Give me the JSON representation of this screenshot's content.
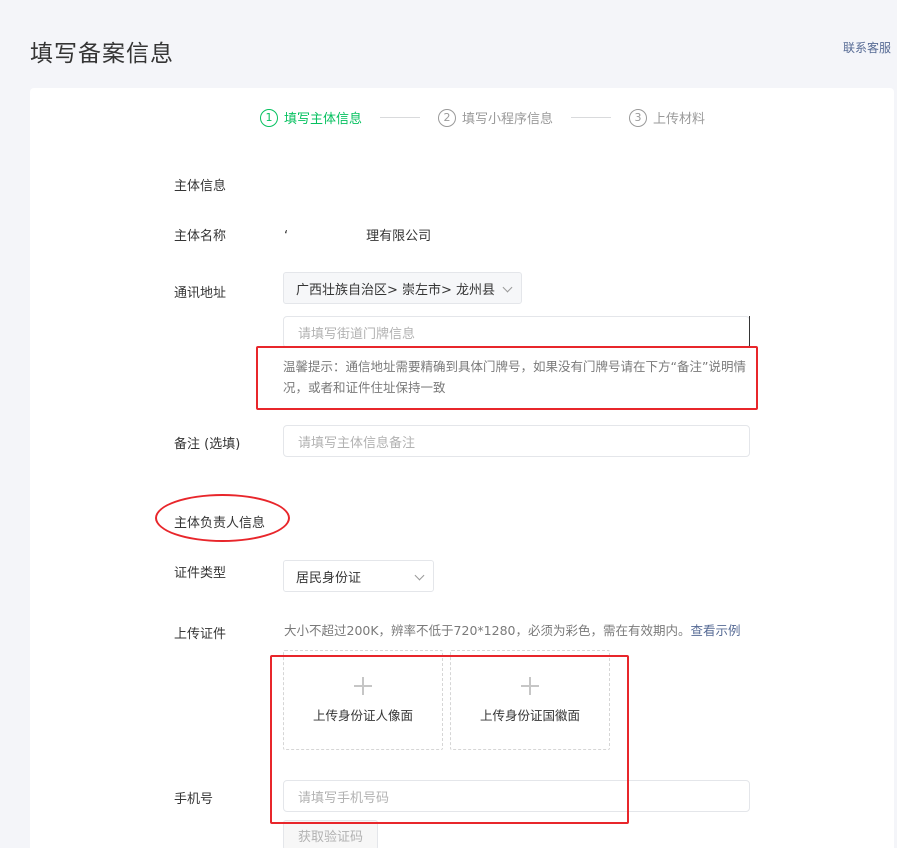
{
  "header": {
    "title": "填写备案信息",
    "service_link": "联系客服"
  },
  "steps": [
    {
      "num": "1",
      "label": "填写主体信息"
    },
    {
      "num": "2",
      "label": "填写小程序信息"
    },
    {
      "num": "3",
      "label": "上传材料"
    }
  ],
  "subject": {
    "section_title": "主体信息",
    "name_label": "主体名称",
    "name_value_prefix": "‘",
    "name_value_suffix": "理有限公司",
    "address_label": "通讯地址",
    "address_region": "广西壮族自治区> 崇左市> 龙州县",
    "street_placeholder": "请填写街道门牌信息",
    "address_hint": "温馨提示：通信地址需要精确到具体门牌号，如果没有门牌号请在下方“备注”说明情况，或者和证件住址保持一致",
    "remark_label": "备注 (选填)",
    "remark_placeholder": "请填写主体信息备注"
  },
  "principal": {
    "section_title": "主体负责人信息",
    "id_type_label": "证件类型",
    "id_type_value": "居民身份证",
    "upload_label": "上传证件",
    "upload_hint": "大小不超过200K，辨率不低于720*1280，必须为彩色，需在有效期内。",
    "example_link": "查看示例",
    "upload_front": "上传身份证人像面",
    "upload_back": "上传身份证国徽面",
    "phone_label": "手机号",
    "phone_placeholder": "请填写手机号码",
    "sms_button": "获取验证码"
  },
  "colors": {
    "accent": "#07c160",
    "link": "#576b95",
    "annotation": "#e8262b"
  }
}
